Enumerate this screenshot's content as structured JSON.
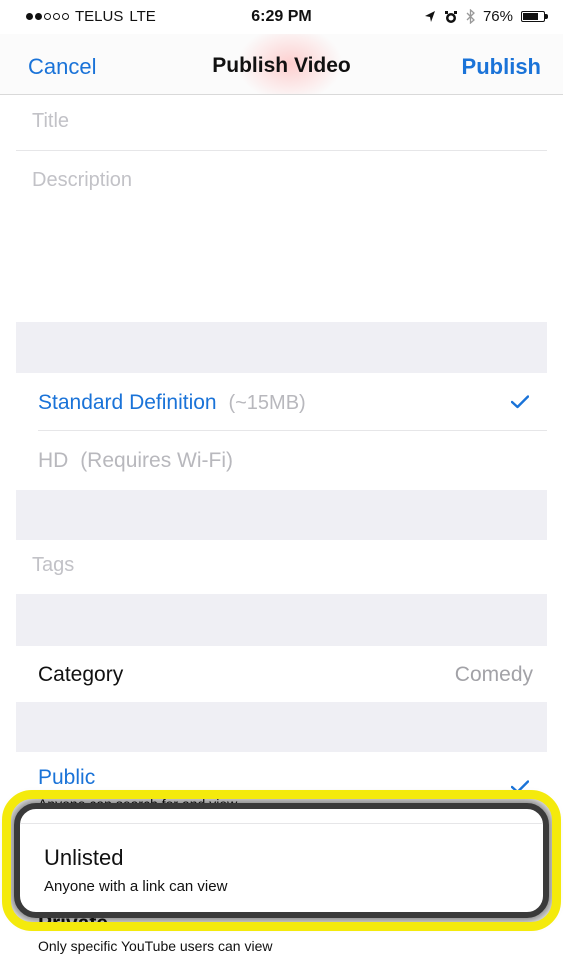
{
  "status_bar": {
    "carrier": "TELUS",
    "network": "LTE",
    "time": "6:29 PM",
    "battery": "76%",
    "battery_level": 0.76,
    "signal_bars_filled": 2,
    "signal_bars_total": 5
  },
  "nav": {
    "cancel_label": "Cancel",
    "title": "Publish Video",
    "publish_label": "Publish"
  },
  "form": {
    "title_placeholder": "Title",
    "description_placeholder": "Description"
  },
  "quality": {
    "standard_label": "Standard Definition",
    "standard_size": "(~15MB)",
    "standard_selected": true,
    "hd_label": "HD",
    "hd_note": "(Requires Wi-Fi)"
  },
  "tags": {
    "placeholder": "Tags"
  },
  "category": {
    "label": "Category",
    "value": "Comedy"
  },
  "privacy": {
    "public_label": "Public",
    "public_subtitle": "Anyone can search for and view",
    "public_selected": true,
    "unlisted_label": "Unlisted",
    "unlisted_subtitle": "Anyone with a link can view",
    "private_label": "Private",
    "private_subtitle": "Only specific YouTube users can view"
  },
  "colors": {
    "accent": "#1a73d8",
    "highlight": "#f4ea0c",
    "group_background": "#efeff4"
  }
}
